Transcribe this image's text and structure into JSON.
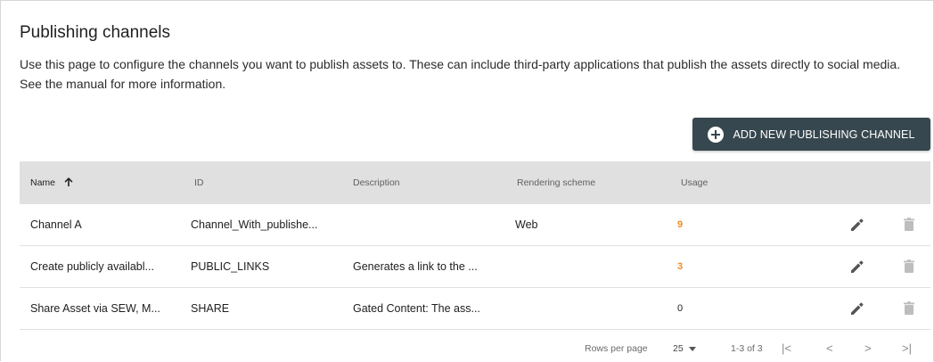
{
  "page": {
    "title": "Publishing channels",
    "description": "Use this page to configure the channels you want to publish assets to. These can include third-party applications that publish the assets directly to social media. See the manual for more information."
  },
  "toolbar": {
    "add_label": "ADD NEW PUBLISHING CHANNEL"
  },
  "table": {
    "columns": [
      "Name",
      "ID",
      "Description",
      "Rendering scheme",
      "Usage"
    ],
    "sorted_by": "Name",
    "sort_direction": "ascending",
    "rows": [
      {
        "name": "Channel A",
        "id": "Channel_With_publishe...",
        "description": "",
        "rendering_scheme": "Web",
        "usage": "9"
      },
      {
        "name": "Create publicly availabl...",
        "id": "PUBLIC_LINKS",
        "description": "Generates a link to the ...",
        "rendering_scheme": "",
        "usage": "3"
      },
      {
        "name": "Share Asset via SEW, M...",
        "id": "SHARE",
        "description": "Gated Content: The ass...",
        "rendering_scheme": "",
        "usage": "0"
      }
    ]
  },
  "pagination": {
    "rows_per_page_label": "Rows per page",
    "rows_per_page_value": "25",
    "range": "1-3 of 3",
    "first": "|<",
    "prev": "<",
    "next": ">",
    "last": ">|"
  },
  "colors": {
    "button_bg": "#37474f",
    "header_bg": "#e0e0e0",
    "usage_accent": "#ef8c1f",
    "icon": "#555555",
    "icon_disabled": "#bdbdbd"
  },
  "icons": {
    "add": "plus-circle-icon",
    "sort": "arrow-up-icon",
    "edit": "pencil-icon",
    "delete": "trash-icon"
  }
}
